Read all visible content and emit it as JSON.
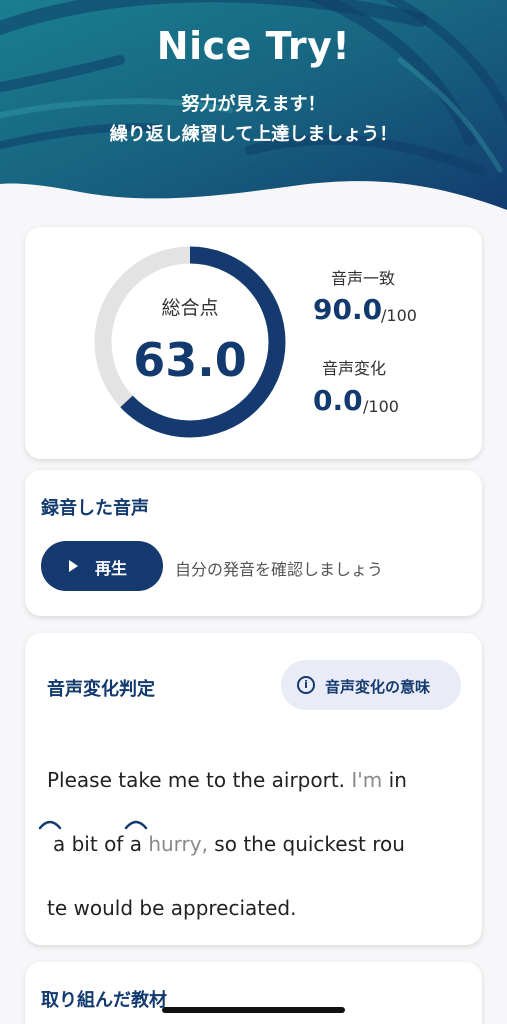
{
  "header": {
    "title": "Nice Try!",
    "subtitle_line1": "努力が見えます！",
    "subtitle_line2": "繰り返し練習して上達しましょう！"
  },
  "score": {
    "total_label": "総合点",
    "total_value": "63.0",
    "total_fraction": 0.63,
    "match_label": "音声一致",
    "match_value": "90.0",
    "match_max": "/100",
    "change_label": "音声変化",
    "change_value": "0.0",
    "change_max": "/100"
  },
  "recording": {
    "title": "録音した音声",
    "play_label": "再生",
    "hint": "自分の発音を確認しましょう"
  },
  "voice_change": {
    "title": "音声変化判定",
    "meaning_button": "音声変化の意味",
    "line1_a": "Please take me to the airport. ",
    "line1_b": "I'm",
    "line1_c": " in",
    "line2_a": "a bit of a ",
    "line2_b": "hurry,",
    "line2_c": " so the quickest rou",
    "line3": "te would be appreciated."
  },
  "materials": {
    "title": "取り組んだ教材"
  },
  "colors": {
    "primary": "#143a6f",
    "gauge_track": "#e3e3e3",
    "hero_teal": "#1d6f86"
  }
}
